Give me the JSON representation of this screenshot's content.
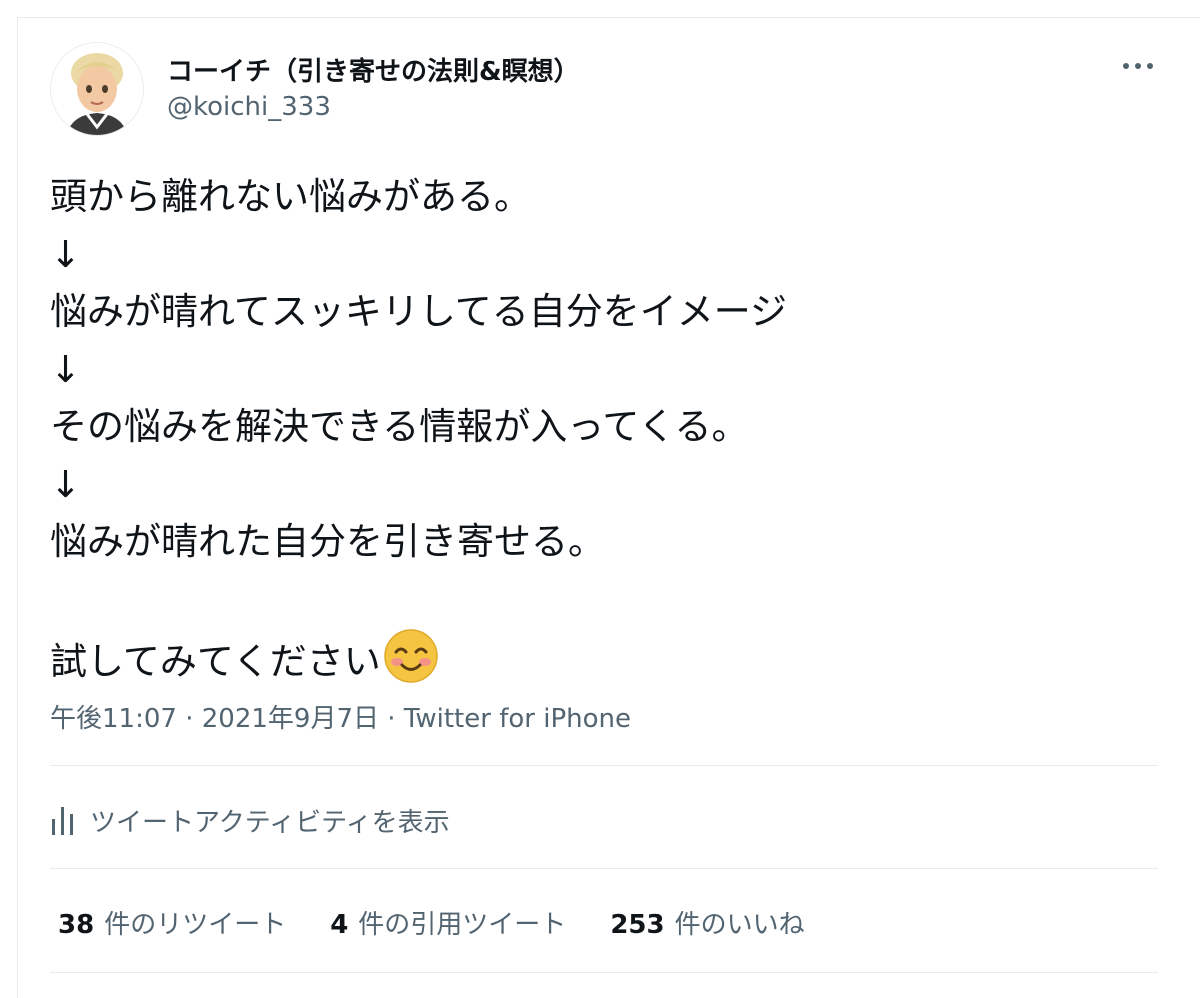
{
  "author": {
    "display_name": "コーイチ（引き寄せの法則&瞑想）",
    "handle": "@koichi_333"
  },
  "tweet": {
    "lines": [
      "頭から離れない悩みがある。",
      "↓",
      "悩みが晴れてスッキリしてる自分をイメージ",
      "↓",
      "その悩みを解決できる情報が入ってくる。",
      "↓",
      "悩みが晴れた自分を引き寄せる。",
      "",
      "試してみてください"
    ],
    "emoji": "smiling-face-with-blush-icon"
  },
  "meta": {
    "time": "午後11:07",
    "separator1": " · ",
    "date": "2021年9月7日",
    "separator2": " · ",
    "source": "Twitter for iPhone"
  },
  "activity": {
    "label": "ツイートアクティビティを表示",
    "icon": "analytics-bars-icon"
  },
  "stats": {
    "retweets_count": "38",
    "retweets_label": "件のリツイート",
    "quotes_count": "4",
    "quotes_label": "件の引用ツイート",
    "likes_count": "253",
    "likes_label": "件のいいね"
  },
  "colors": {
    "text_primary": "#0f1419",
    "text_secondary": "#536471",
    "divider": "#e6ecf0",
    "emoji_face": "#f5c542",
    "emoji_blush": "#f48a94"
  }
}
